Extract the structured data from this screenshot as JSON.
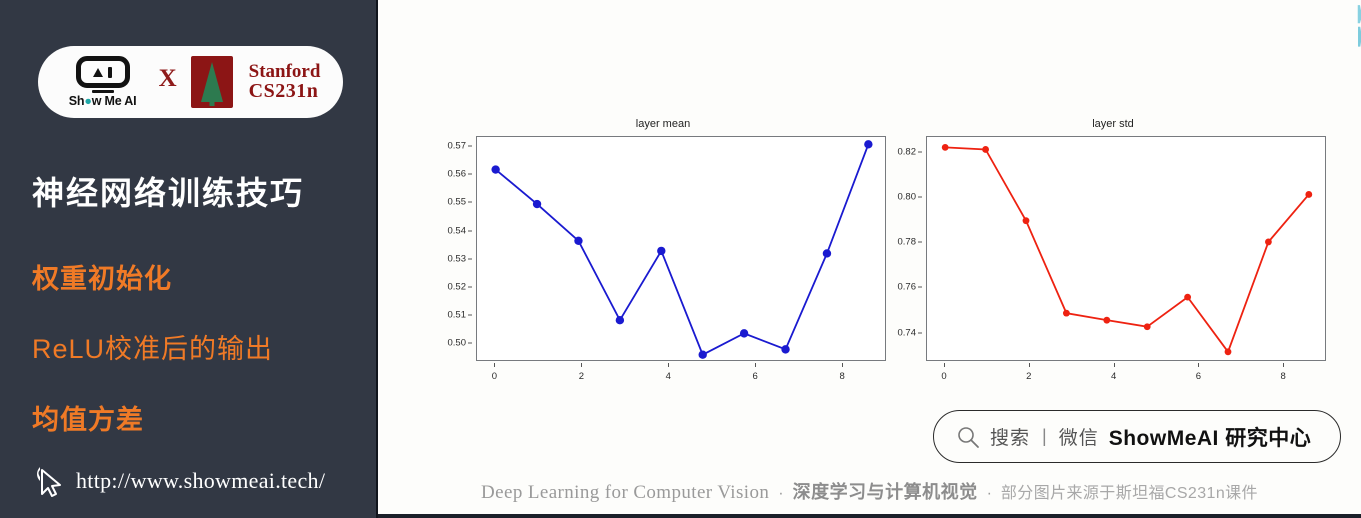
{
  "sidebar": {
    "logo": {
      "showmeai_label": "Show Me AI",
      "x_label": "X",
      "stanford_line1": "Stanford",
      "stanford_line2": "CS231n"
    },
    "title": "神经网络训练技巧",
    "subtitles": [
      "权重初始化",
      "ReLU校准后的输出",
      "均值方差"
    ],
    "url": "http://www.showmeai.tech/",
    "colors": {
      "background": "#323844",
      "title": "#ffffff",
      "accent": "#F07A26"
    }
  },
  "watermark": {
    "text": "ShowMeAI"
  },
  "search_pill": {
    "search_label": "搜索",
    "divider": "|",
    "wechat_label": "微信",
    "brand": "ShowMeAI 研究中心"
  },
  "footer": {
    "english": "Deep Learning for Computer Vision",
    "sep1": "·",
    "chinese_bold": "深度学习与计算机视觉",
    "sep2": "·",
    "chinese_note": "部分图片来源于斯坦福CS231n课件"
  },
  "chart_data": [
    {
      "type": "line",
      "title": "layer mean",
      "xlabel": "",
      "ylabel": "",
      "color": "#1a1ad0",
      "x": [
        0,
        1,
        2,
        3,
        4,
        5,
        6,
        7,
        8,
        9
      ],
      "values": [
        0.5624,
        0.5501,
        0.537,
        0.5087,
        0.5334,
        0.4964,
        0.504,
        0.4983,
        0.5325,
        0.5714
      ],
      "xticks": [
        0,
        2,
        4,
        6,
        8
      ],
      "xtick_labels": [
        "0",
        "2",
        "4",
        "6",
        "8"
      ],
      "yticks": [
        0.5,
        0.51,
        0.52,
        0.53,
        0.54,
        0.55,
        0.56,
        0.57
      ],
      "ytick_labels": [
        "0.50",
        "0.51",
        "0.52",
        "0.53",
        "0.54",
        "0.55",
        "0.56",
        "0.57"
      ],
      "xlim": [
        -0.45,
        9.45
      ],
      "ylim": [
        0.4938,
        0.574
      ],
      "grid": false,
      "legend": "none",
      "marker": "o"
    },
    {
      "type": "line",
      "title": "layer std",
      "xlabel": "",
      "ylabel": "",
      "color": "#ee2211",
      "x": [
        0,
        1,
        2,
        3,
        4,
        5,
        6,
        7,
        8,
        9
      ],
      "values": [
        0.8254,
        0.8245,
        0.793,
        0.7521,
        0.749,
        0.7461,
        0.7592,
        0.735,
        0.7836,
        0.8046
      ],
      "xticks": [
        0,
        2,
        4,
        6,
        8
      ],
      "xtick_labels": [
        "0",
        "2",
        "4",
        "6",
        "8"
      ],
      "yticks": [
        0.74,
        0.76,
        0.78,
        0.8,
        0.82
      ],
      "ytick_labels": [
        "0.74",
        "0.76",
        "0.78",
        "0.80",
        "0.82"
      ],
      "xlim": [
        -0.45,
        9.45
      ],
      "ylim": [
        0.7305,
        0.83
      ],
      "grid": false,
      "legend": "none",
      "marker": "o"
    }
  ]
}
